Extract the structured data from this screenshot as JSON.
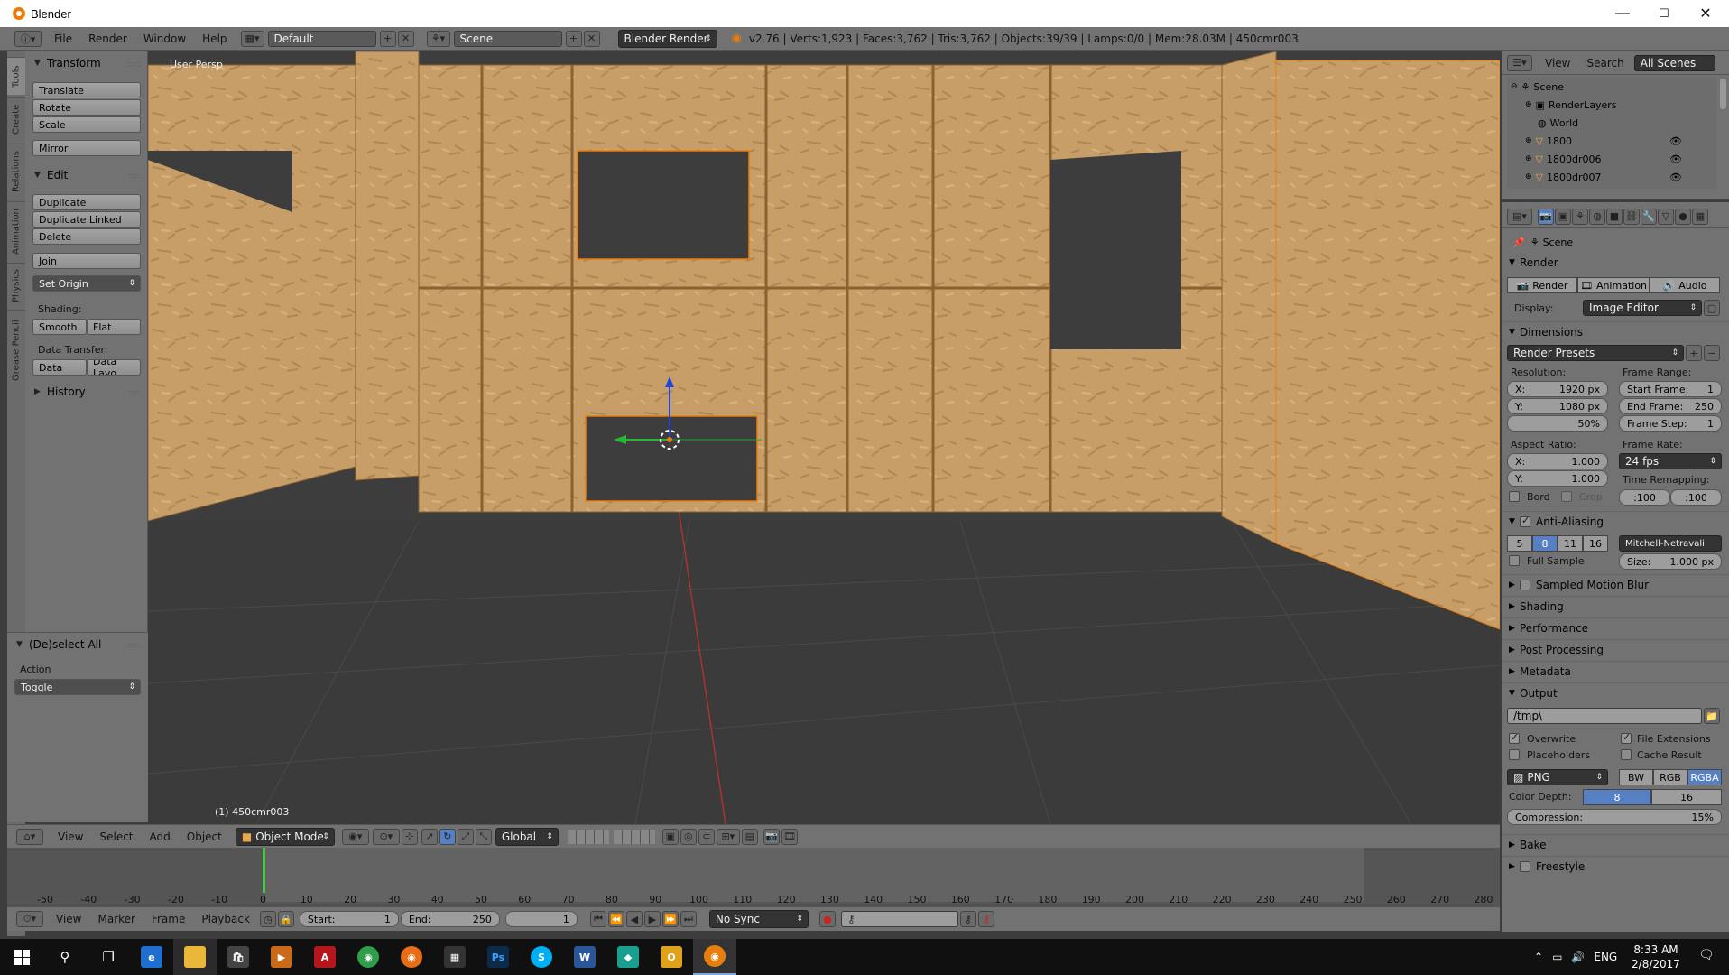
{
  "window": {
    "title": "Blender",
    "min": "—",
    "max": "☐",
    "close": "✕"
  },
  "infobar": {
    "menus": [
      "File",
      "Render",
      "Window",
      "Help"
    ],
    "layout": "Default",
    "scene": "Scene",
    "engine": "Blender Render",
    "stats": "v2.76 | Verts:1,923 | Faces:3,762 | Tris:3,762 | Objects:39/39 | Lamps:0/0 | Mem:28.03M | 450cmr003"
  },
  "tabs": [
    "Tools",
    "Create",
    "Relations",
    "Animation",
    "Physics",
    "Grease Pencil"
  ],
  "toolshelf": {
    "transform": {
      "title": "Transform",
      "buttons": [
        "Translate",
        "Rotate",
        "Scale",
        "Mirror"
      ]
    },
    "edit": {
      "title": "Edit",
      "buttons": [
        "Duplicate",
        "Duplicate Linked",
        "Delete",
        "Join"
      ],
      "set_origin": "Set Origin",
      "shading_label": "Shading:",
      "smooth": "Smooth",
      "flat": "Flat",
      "data_transfer_label": "Data Transfer:",
      "data": "Data",
      "data_layout": "Data Layo"
    },
    "history": {
      "title": "History"
    },
    "deselect": {
      "title": "(De)select All",
      "action_label": "Action",
      "action_value": "Toggle"
    }
  },
  "viewport": {
    "label": "User Persp",
    "object_label": "(1) 450cmr003"
  },
  "viewheader": {
    "menus": [
      "View",
      "Select",
      "Add",
      "Object"
    ],
    "mode": "Object Mode",
    "orientation": "Global"
  },
  "timeline": {
    "ticks": [
      "-50",
      "-40",
      "-30",
      "-20",
      "-10",
      "0",
      "10",
      "20",
      "30",
      "40",
      "50",
      "60",
      "70",
      "80",
      "90",
      "100",
      "110",
      "120",
      "130",
      "140",
      "150",
      "160",
      "170",
      "180",
      "190",
      "200",
      "210",
      "220",
      "230",
      "240",
      "250",
      "260",
      "270",
      "280"
    ],
    "menus": [
      "View",
      "Marker",
      "Frame",
      "Playback"
    ],
    "start_label": "Start:",
    "start_value": "1",
    "end_label": "End:",
    "end_value": "250",
    "current": "1",
    "sync": "No Sync"
  },
  "outliner": {
    "menus": [
      "View",
      "Search"
    ],
    "filter": "All Scenes",
    "items": [
      "Scene",
      "RenderLayers",
      "World",
      "1800",
      "1800dr006",
      "1800dr007"
    ]
  },
  "properties": {
    "breadcrumb": "Scene",
    "render": {
      "title": "Render",
      "buttons": [
        "Render",
        "Animation",
        "Audio"
      ],
      "display_label": "Display:",
      "display_value": "Image Editor"
    },
    "dimensions": {
      "title": "Dimensions",
      "presets": "Render Presets",
      "resolution_label": "Resolution:",
      "res_x": "1920 px",
      "res_y": "1080 px",
      "res_pct": "50%",
      "frame_range_label": "Frame Range:",
      "start_frame": "1",
      "end_frame": "250",
      "frame_step": "1",
      "start_frame_label": "Start Frame:",
      "end_frame_label": "End Frame:",
      "frame_step_label": "Frame Step:",
      "aspect_label": "Aspect Ratio:",
      "aspect_x": "1.000",
      "aspect_y": "1.000",
      "frame_rate_label": "Frame Rate:",
      "frame_rate": "24 fps",
      "time_remap_label": "Time Remapping:",
      "remap_old": ":100",
      "remap_new": ":100",
      "bord": "Bord",
      "crop": "Crop",
      "x_label": "X:",
      "y_label": "Y:"
    },
    "aa": {
      "title": "Anti-Aliasing",
      "samples": [
        "5",
        "8",
        "11",
        "16"
      ],
      "filter": "Mitchell-Netravali",
      "full_sample": "Full Sample",
      "size_label": "Size:",
      "size_value": "1.000 px"
    },
    "sections": [
      "Sampled Motion Blur",
      "Shading",
      "Performance",
      "Post Processing",
      "Metadata"
    ],
    "output": {
      "title": "Output",
      "path": "/tmp\\",
      "overwrite": "Overwrite",
      "file_ext": "File Extensions",
      "placeholders": "Placeholders",
      "cache": "Cache Result",
      "format": "PNG",
      "modes": [
        "BW",
        "RGB",
        "RGBA"
      ],
      "depth_label": "Color Depth:",
      "depths": [
        "8",
        "16"
      ],
      "compression_label": "Compression:",
      "compression_value": "15%"
    },
    "bake": "Bake",
    "freestyle": "Freestyle"
  },
  "taskbar": {
    "lang": "ENG",
    "time": "8:33 AM",
    "date": "2/8/2017"
  },
  "colors": {
    "wood": "#c9a06a",
    "wood_dark": "#a47a45",
    "accent": "#5680c2",
    "selected_orange": "#e87d0d"
  }
}
